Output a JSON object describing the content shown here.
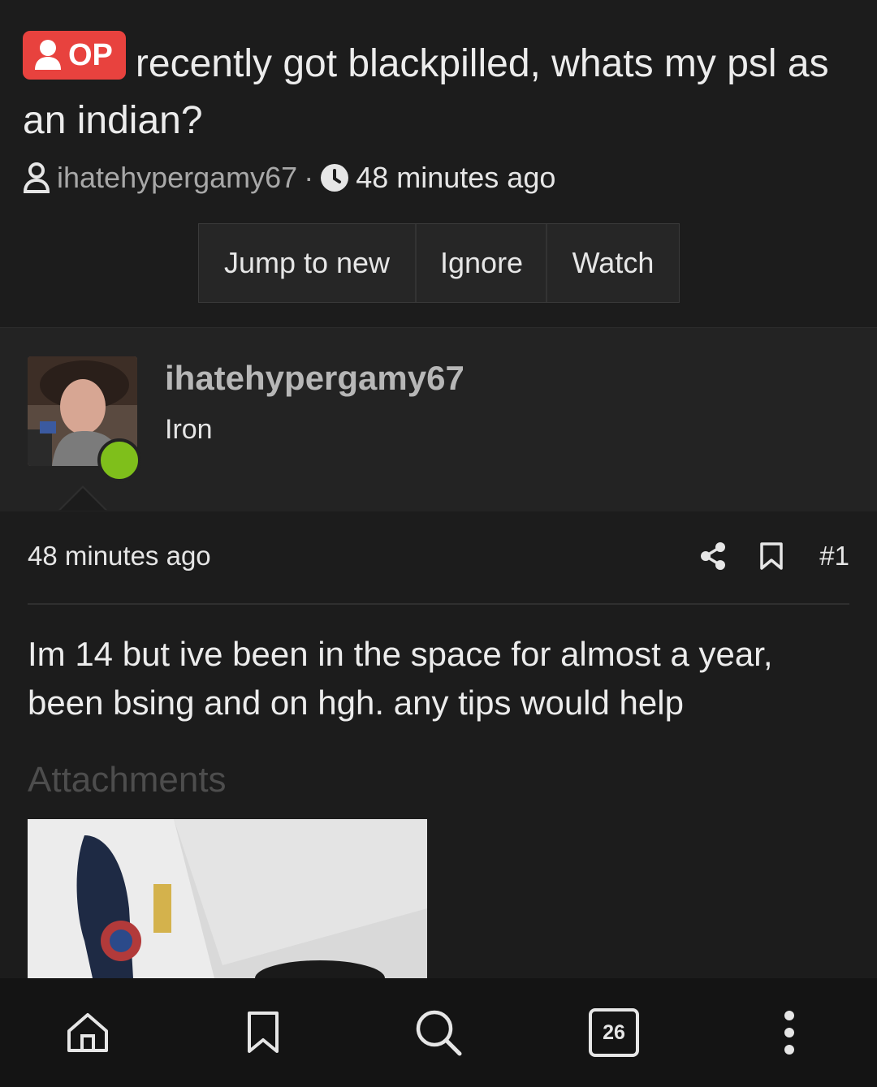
{
  "thread": {
    "op_badge": "OP",
    "title": "recently got blackpilled, whats my psl as an indian?",
    "author": "ihatehypergamy67",
    "separator": "·",
    "time": "48 minutes ago"
  },
  "buttons": {
    "jump": "Jump to new",
    "ignore": "Ignore",
    "watch": "Watch"
  },
  "user": {
    "name": "ihatehypergamy67",
    "rank": "Iron",
    "status_color": "#7fbf1b"
  },
  "post": {
    "time": "48 minutes ago",
    "number": "#1",
    "body": "Im 14 but ive been in the space for almost a year, been bsing and on hgh. any tips would help",
    "attachments_label": "Attachments"
  },
  "nav": {
    "tabs_count": "26",
    "icons": [
      "home-icon",
      "bookmark-icon",
      "search-icon",
      "tabs-icon",
      "more-icon"
    ]
  },
  "colors": {
    "op_badge": "#e8423e",
    "background": "#1c1c1c"
  }
}
